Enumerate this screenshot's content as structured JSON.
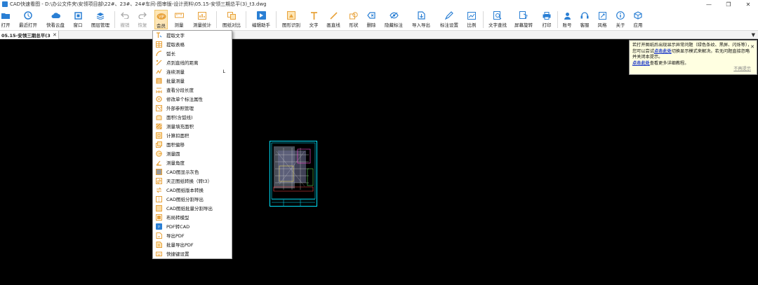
{
  "window": {
    "title": "CAD快速看图 - D:\\办公文件夹\\安领项目部\\22#、23#、24#车间-图审版-设计资料\\05.15-安领三期总平(3)_t3.dwg",
    "minimize": "—",
    "restore": "❐",
    "close": "✕"
  },
  "toolbar": {
    "items": [
      {
        "label": "打开",
        "icon": "folder-icon"
      },
      {
        "label": "最近打开",
        "icon": "history-icon"
      },
      {
        "label": "快看云盘",
        "icon": "cloud-icon"
      },
      {
        "label": "窗口",
        "icon": "window-icon"
      },
      {
        "label": "图层管理",
        "icon": "layers-icon"
      },
      {
        "label": "撤销",
        "icon": "undo-icon"
      },
      {
        "label": "恢复",
        "icon": "redo-icon"
      },
      {
        "label": "会员",
        "icon": "vip-icon"
      },
      {
        "label": "测量",
        "icon": "measure-icon"
      },
      {
        "label": "测量统计",
        "icon": "measure-stats-icon"
      },
      {
        "label": "图纸对比",
        "icon": "compare-icon"
      },
      {
        "label": "编辑助手",
        "icon": "edit-assistant-icon"
      },
      {
        "label": "图形识别",
        "icon": "shape-recognize-icon"
      },
      {
        "label": "文字",
        "icon": "text-icon"
      },
      {
        "label": "画直线",
        "icon": "line-icon"
      },
      {
        "label": "形状",
        "icon": "shape-icon"
      },
      {
        "label": "删除",
        "icon": "delete-icon"
      },
      {
        "label": "隐藏标注",
        "icon": "hide-annotation-icon"
      },
      {
        "label": "导入导出",
        "icon": "import-export-icon"
      },
      {
        "label": "标注设置",
        "icon": "annotation-settings-icon"
      },
      {
        "label": "比例",
        "icon": "scale-icon"
      },
      {
        "label": "文字查找",
        "icon": "text-search-icon"
      },
      {
        "label": "屏幕旋转",
        "icon": "rotate-icon"
      },
      {
        "label": "打印",
        "icon": "print-icon"
      },
      {
        "label": "账号",
        "icon": "account-icon"
      },
      {
        "label": "客服",
        "icon": "support-icon"
      },
      {
        "label": "风格",
        "icon": "style-icon"
      },
      {
        "label": "关于",
        "icon": "about-icon"
      },
      {
        "label": "应用",
        "icon": "apps-icon"
      }
    ]
  },
  "tabs": {
    "active_label": "05.15-安领三期总平(3",
    "close": "✕",
    "dropdown": "▼"
  },
  "menu": {
    "items": [
      {
        "label": "提取文字",
        "icon": "extract-text-icon"
      },
      {
        "label": "提取表格",
        "icon": "extract-table-icon"
      },
      {
        "label": "弧长",
        "icon": "arc-length-icon"
      },
      {
        "label": "点到直线的距离",
        "icon": "point-line-distance-icon"
      },
      {
        "label": "连续测量",
        "icon": "continuous-measure-icon",
        "shortcut": "L"
      },
      {
        "label": "批量测量",
        "icon": "batch-measure-icon"
      },
      {
        "label": "查看分段长度",
        "icon": "segment-length-icon"
      },
      {
        "label": "修改单个标注属性",
        "icon": "edit-annotation-icon"
      },
      {
        "label": "外部参照管理",
        "icon": "xref-icon"
      },
      {
        "label": "面积(含弧线)",
        "icon": "area-arc-icon"
      },
      {
        "label": "测量填充面积",
        "icon": "fill-area-icon"
      },
      {
        "label": "计算扣面积",
        "icon": "subtract-area-icon"
      },
      {
        "label": "面积偏移",
        "icon": "area-offset-icon"
      },
      {
        "label": "测量圆",
        "icon": "circle-measure-icon"
      },
      {
        "label": "测量角度",
        "icon": "angle-icon"
      },
      {
        "label": "CAD图显示灰色",
        "icon": "grayscale-icon"
      },
      {
        "label": "天正图纸转换（转t3）",
        "icon": "tangent-convert-icon"
      },
      {
        "label": "CAD图纸版本转换",
        "icon": "version-convert-icon"
      },
      {
        "label": "CAD图纸分割导出",
        "icon": "split-export-icon"
      },
      {
        "label": "CAD图纸批量分割导出",
        "icon": "batch-split-icon"
      },
      {
        "label": "布局转模型",
        "icon": "layout-model-icon"
      },
      {
        "label": "PDF转CAD",
        "icon": "pdf-cad-icon"
      },
      {
        "label": "导出PDF",
        "icon": "export-pdf-icon"
      },
      {
        "label": "批量导出PDF",
        "icon": "batch-pdf-icon"
      },
      {
        "label": "快捷键设置",
        "icon": "keyboard-icon"
      }
    ]
  },
  "notification": {
    "text1": "若打开图纸后出现显示异常问题（绿色条纹、黑屏、闪烁等），您可以尝试",
    "link1": "点击此处",
    "text2": "切换显示模式来解决。若无问题直接忽略并关闭本提示。",
    "link2": "点击此处",
    "text3": "查看更多详细教程。",
    "dismiss": "不再提示",
    "close": "✕"
  },
  "colors": {
    "accent_blue": "#2a7fd4",
    "menu_icon_orange": "#e8a23a",
    "drawing_cyan": "#00e5ff"
  }
}
